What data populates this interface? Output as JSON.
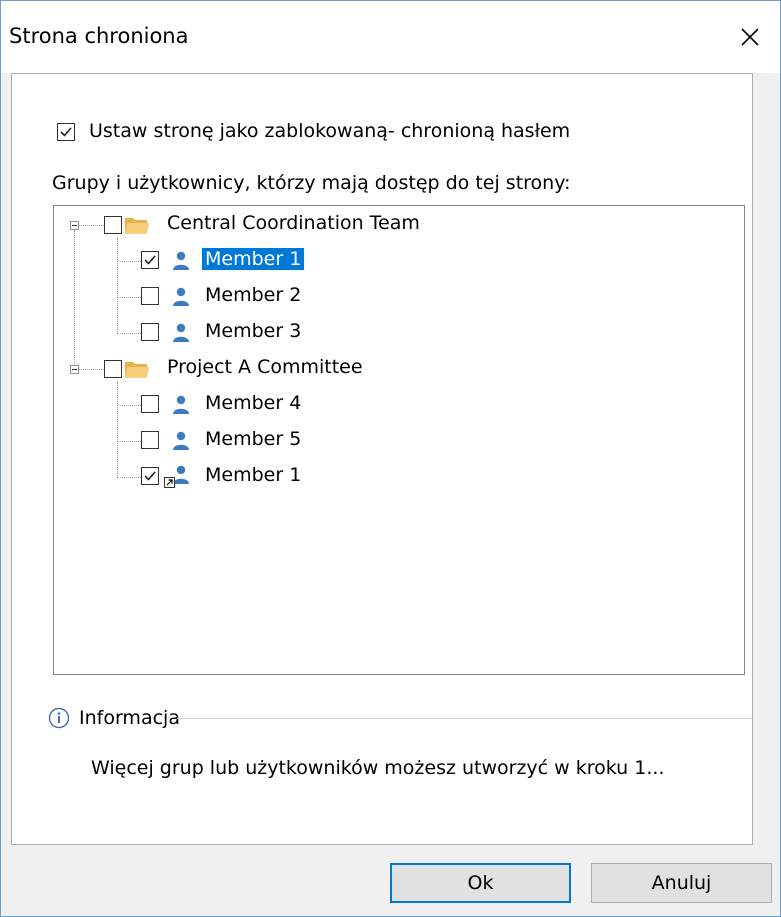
{
  "window": {
    "title": "Strona chroniona"
  },
  "protect": {
    "label": "Ustaw stronę jako zablokowaną- chronioną hasłem",
    "checked": true
  },
  "tree": {
    "header": "Grupy i użytkownicy, którzy mają dostęp do tej strony:",
    "groups": [
      {
        "name": "Central Coordination Team",
        "members": [
          {
            "name": "Member 1",
            "checked": true,
            "selected": true
          },
          {
            "name": "Member 2",
            "checked": false
          },
          {
            "name": "Member 3",
            "checked": false
          }
        ]
      },
      {
        "name": "Project A Committee",
        "members": [
          {
            "name": "Member 4",
            "checked": false
          },
          {
            "name": "Member 5",
            "checked": false
          },
          {
            "name": "Member 1",
            "checked": true,
            "shortcut": true
          }
        ]
      }
    ]
  },
  "info": {
    "title": "Informacja",
    "text": "Więcej grup lub użytkowników możesz utworzyć w kroku 1..."
  },
  "buttons": {
    "ok": "Ok",
    "cancel": "Anuluj"
  },
  "colors": {
    "accent": "#0078d7",
    "user_icon": "#3b7bbf",
    "folder": "#f3c66b"
  }
}
